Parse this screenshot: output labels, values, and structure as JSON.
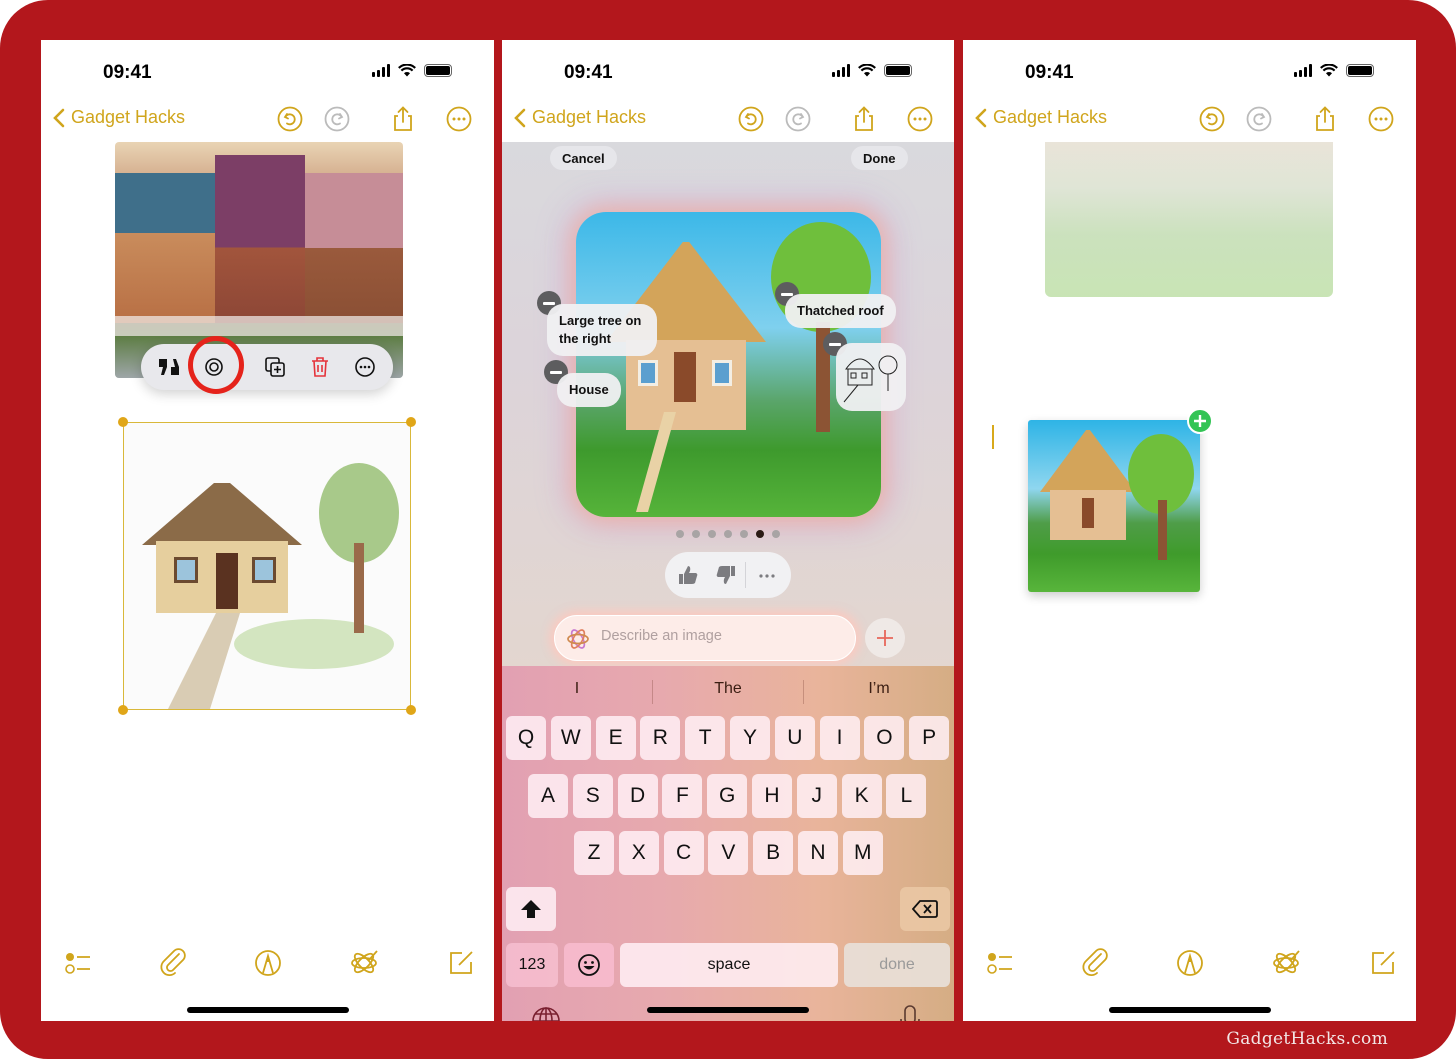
{
  "watermark": "GadgetHacks.com",
  "colors": {
    "frame": "#b3171c",
    "accent": "#d0a51c",
    "highlight": "#e5231b",
    "add": "#33c455"
  },
  "status_bar": {
    "time": "09:41",
    "icons": [
      "signal-icon",
      "wifi-icon",
      "battery-icon"
    ]
  },
  "nav": {
    "back_label": "Gadget Hacks",
    "buttons": [
      "undo-icon",
      "redo-icon",
      "share-icon",
      "more-icon"
    ]
  },
  "toolbar": {
    "buttons": [
      "checklist-icon",
      "attachment-icon",
      "markup-icon",
      "image-playground-icon",
      "compose-icon"
    ]
  },
  "panel1": {
    "image_menu": {
      "items": [
        "feedback-icon",
        "image-playground-icon",
        "duplicate-icon",
        "delete-icon",
        "more-icon"
      ],
      "highlighted": "image-playground-icon"
    }
  },
  "panel2": {
    "cancel_label": "Cancel",
    "done_label": "Done",
    "concept_chips": [
      "Large tree on the right",
      "House",
      "Thatched roof"
    ],
    "sketch_chip": "sketch-thumbnail",
    "page_dots": {
      "count": 7,
      "active_index": 5
    },
    "feedback": [
      "thumbs-up-icon",
      "thumbs-down-icon",
      "more-icon"
    ],
    "prompt_placeholder": "Describe an image",
    "keyboard": {
      "suggestions": [
        "I",
        "The",
        "I’m"
      ],
      "row1": [
        "Q",
        "W",
        "E",
        "R",
        "T",
        "Y",
        "U",
        "I",
        "O",
        "P"
      ],
      "row2": [
        "A",
        "S",
        "D",
        "F",
        "G",
        "H",
        "J",
        "K",
        "L"
      ],
      "row3": [
        "Z",
        "X",
        "C",
        "V",
        "B",
        "N",
        "M"
      ],
      "numbers_label": "123",
      "space_label": "space",
      "done_label": "done"
    }
  },
  "panel3": {}
}
